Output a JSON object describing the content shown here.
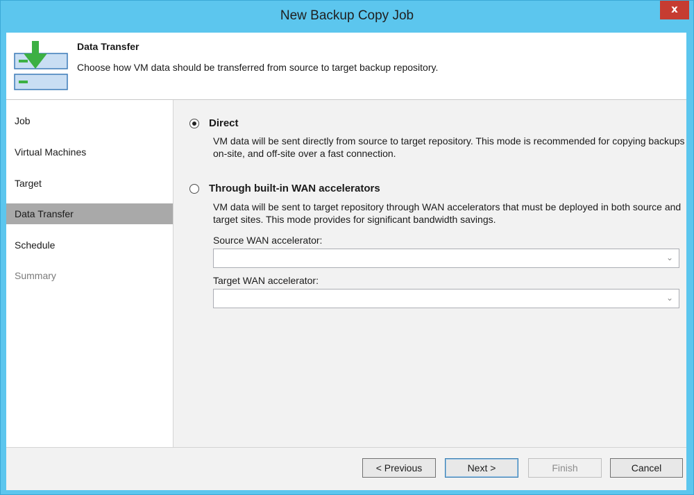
{
  "window": {
    "title": "New Backup Copy Job",
    "close_label": "x"
  },
  "header": {
    "title": "Data Transfer",
    "description": "Choose how VM data should be transferred from source to target backup repository.",
    "icon": "backup-transfer-icon"
  },
  "sidebar": {
    "items": [
      {
        "label": "Job",
        "state": "normal"
      },
      {
        "label": "Virtual Machines",
        "state": "normal"
      },
      {
        "label": "Target",
        "state": "normal"
      },
      {
        "label": "Data Transfer",
        "state": "selected"
      },
      {
        "label": "Schedule",
        "state": "normal"
      },
      {
        "label": "Summary",
        "state": "disabled"
      }
    ]
  },
  "main": {
    "direct": {
      "label": "Direct",
      "checked": true,
      "description": "VM data will be sent directly from source to target repository. This mode is recommended for copying backups on-site, and off-site over a fast connection."
    },
    "wan": {
      "label": "Through built-in WAN accelerators",
      "checked": false,
      "description": "VM data will be sent to target repository through WAN accelerators that must be deployed in both source and target sites. This mode provides for significant bandwidth savings.",
      "source_label": "Source WAN accelerator:",
      "source_value": "",
      "target_label": "Target WAN accelerator:",
      "target_value": ""
    }
  },
  "footer": {
    "previous": "< Previous",
    "next": "Next >",
    "finish": "Finish",
    "cancel": "Cancel"
  },
  "colors": {
    "title_bar": "#5cc6ee",
    "close_button": "#c63c31",
    "selected_nav": "#a9a9a9",
    "accent_green": "#3cb043"
  }
}
